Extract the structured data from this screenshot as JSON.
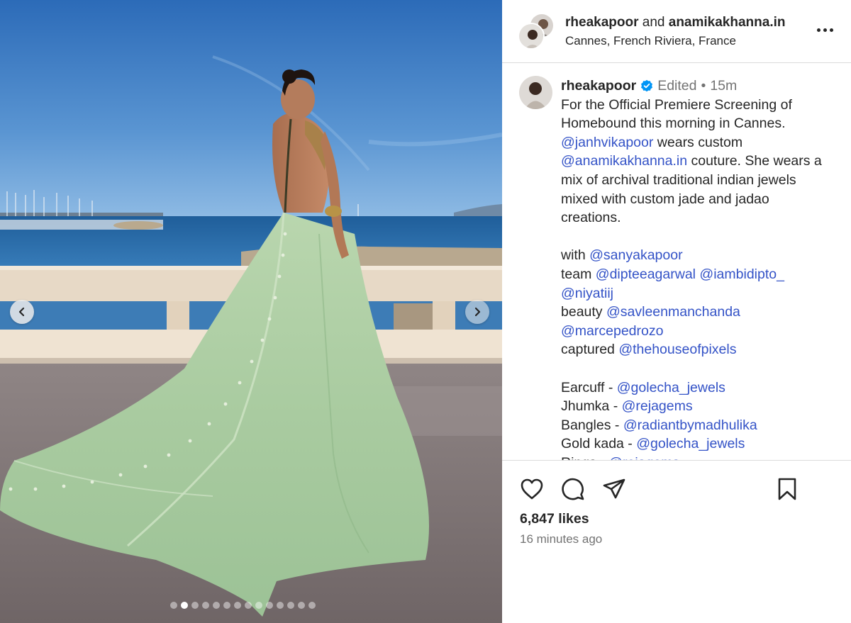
{
  "header": {
    "user1": "rheakapoor",
    "joiner": "and",
    "user2": "anamikakhanna.in",
    "location": "Cannes, French Riviera, France"
  },
  "caption": {
    "username": "rheakapoor",
    "edited": "Edited",
    "separator": "•",
    "time": "15m",
    "lines": [
      [
        {
          "t": "For the Official Premiere Screening of"
        }
      ],
      [
        {
          "t": "Homebound this morning in Cannes."
        }
      ],
      [
        {
          "m": "@janhvikapoor"
        },
        {
          "t": " wears custom"
        }
      ],
      [
        {
          "m": "@anamikakhanna.in"
        },
        {
          "t": " couture. She wears a"
        }
      ],
      [
        {
          "t": "mix of archival traditional indian jewels"
        }
      ],
      [
        {
          "t": "mixed with custom jade and jadao"
        }
      ],
      [
        {
          "t": "creations."
        }
      ],
      [],
      [
        {
          "t": "with "
        },
        {
          "m": "@sanyakapoor"
        }
      ],
      [
        {
          "t": "team "
        },
        {
          "m": "@dipteeagarwal"
        },
        {
          "t": " "
        },
        {
          "m": "@iambidipto_"
        }
      ],
      [
        {
          "m": "@niyatiij"
        }
      ],
      [
        {
          "t": "beauty "
        },
        {
          "m": "@savleenmanchanda"
        }
      ],
      [
        {
          "m": "@marcepedrozo"
        }
      ],
      [
        {
          "t": "captured "
        },
        {
          "m": "@thehouseofpixels"
        }
      ],
      [],
      [
        {
          "t": "Earcuff - "
        },
        {
          "m": "@golecha_jewels"
        }
      ],
      [
        {
          "t": "Jhumka - "
        },
        {
          "m": "@rejagems"
        }
      ],
      [
        {
          "t": "Bangles - "
        },
        {
          "m": "@radiantbymadhulika"
        }
      ],
      [
        {
          "t": "Gold kada - "
        },
        {
          "m": "@golecha_jewels"
        }
      ],
      [
        {
          "t": "Rings - "
        },
        {
          "m": "@rejagems"
        }
      ]
    ]
  },
  "actions": {
    "like_icon": "heart-icon",
    "comment_icon": "comment-icon",
    "share_icon": "send-icon",
    "save_icon": "bookmark-icon"
  },
  "likes": "6,847 likes",
  "posted": "16 minutes ago",
  "carousel": {
    "total": 14,
    "active_index": 1,
    "prev_icon": "chevron-left-icon",
    "next_icon": "chevron-right-icon"
  },
  "colors": {
    "mention": "#3453c7",
    "verified": "#0095f6",
    "text": "#262626",
    "muted": "#737373"
  }
}
